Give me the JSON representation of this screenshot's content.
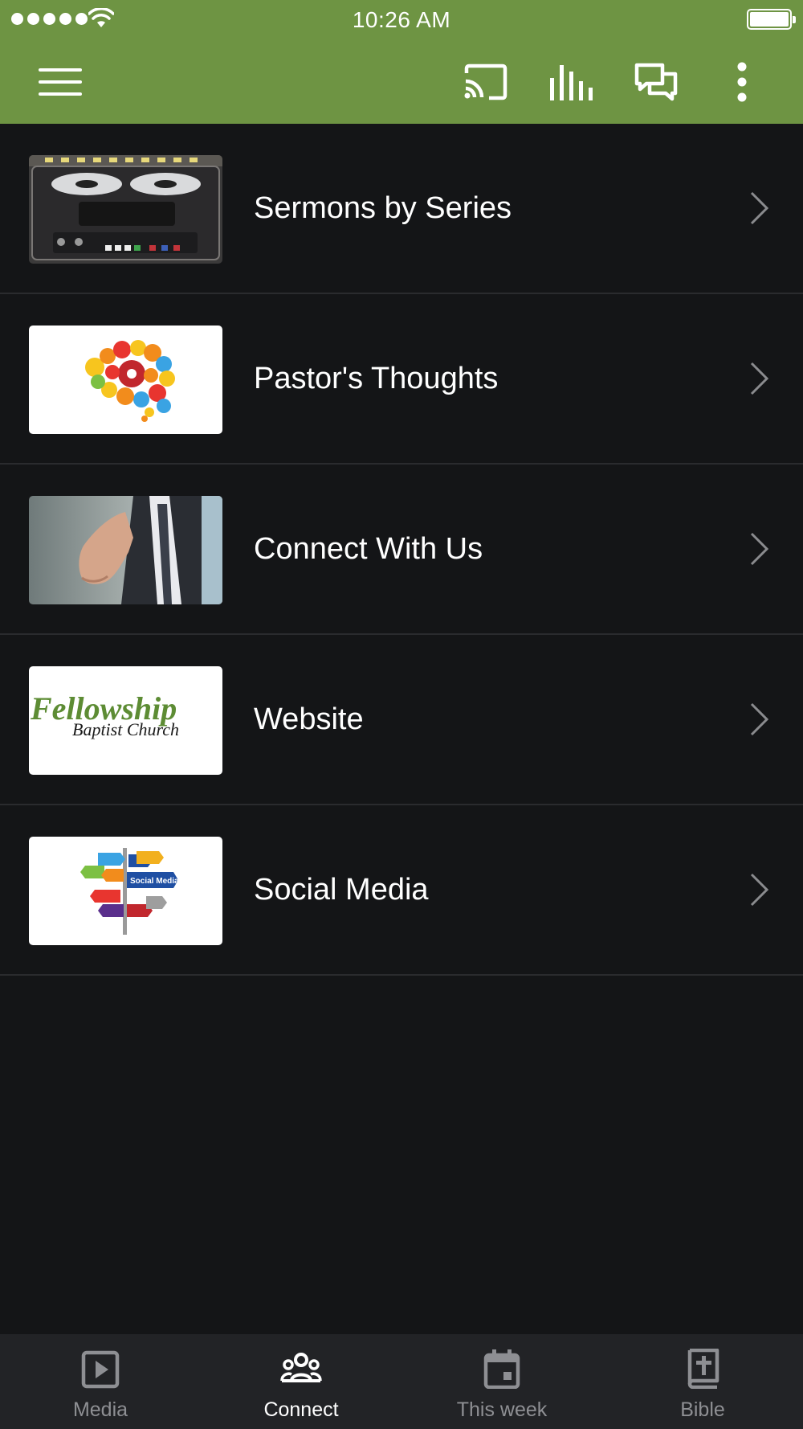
{
  "status_bar": {
    "time": "10:26 AM"
  },
  "app_bar": {
    "icons": [
      "menu-icon",
      "cast-icon",
      "equalizer-icon",
      "chat-icon",
      "more-vert-icon"
    ]
  },
  "colors": {
    "app_bar": "#6e9443",
    "background": "#141517",
    "tab_bar": "#222326",
    "tab_inactive": "#8e8f93",
    "tab_active": "#ffffff"
  },
  "list": {
    "items": [
      {
        "label": "Sermons by Series",
        "thumbnail": "reel-to-reel-tape-recorder"
      },
      {
        "label": "Pastor's Thoughts",
        "thumbnail": "colorful-gear-brain"
      },
      {
        "label": "Connect With Us",
        "thumbnail": "handshake-offer"
      },
      {
        "label": "Website",
        "thumbnail": "fellowship-logo",
        "logo_text": [
          "Fellowship",
          "Baptist Church"
        ]
      },
      {
        "label": "Social Media",
        "thumbnail": "social-media-signpost",
        "sign_text": "Social Media"
      }
    ]
  },
  "tab_bar": {
    "tabs": [
      {
        "label": "Media",
        "icon": "play-box-icon",
        "active": false
      },
      {
        "label": "Connect",
        "icon": "group-icon",
        "active": true
      },
      {
        "label": "This week",
        "icon": "calendar-icon",
        "active": false
      },
      {
        "label": "Bible",
        "icon": "bible-icon",
        "active": false
      }
    ]
  }
}
